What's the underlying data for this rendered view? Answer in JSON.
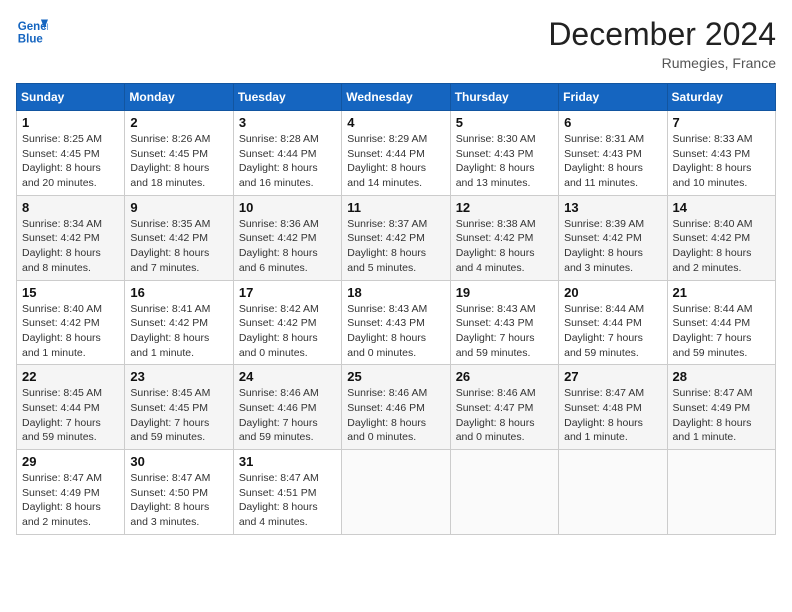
{
  "header": {
    "logo_line1": "General",
    "logo_line2": "Blue",
    "month_title": "December 2024",
    "location": "Rumegies, France"
  },
  "days_of_week": [
    "Sunday",
    "Monday",
    "Tuesday",
    "Wednesday",
    "Thursday",
    "Friday",
    "Saturday"
  ],
  "weeks": [
    [
      {
        "day": "1",
        "info": "Sunrise: 8:25 AM\nSunset: 4:45 PM\nDaylight: 8 hours\nand 20 minutes."
      },
      {
        "day": "2",
        "info": "Sunrise: 8:26 AM\nSunset: 4:45 PM\nDaylight: 8 hours\nand 18 minutes."
      },
      {
        "day": "3",
        "info": "Sunrise: 8:28 AM\nSunset: 4:44 PM\nDaylight: 8 hours\nand 16 minutes."
      },
      {
        "day": "4",
        "info": "Sunrise: 8:29 AM\nSunset: 4:44 PM\nDaylight: 8 hours\nand 14 minutes."
      },
      {
        "day": "5",
        "info": "Sunrise: 8:30 AM\nSunset: 4:43 PM\nDaylight: 8 hours\nand 13 minutes."
      },
      {
        "day": "6",
        "info": "Sunrise: 8:31 AM\nSunset: 4:43 PM\nDaylight: 8 hours\nand 11 minutes."
      },
      {
        "day": "7",
        "info": "Sunrise: 8:33 AM\nSunset: 4:43 PM\nDaylight: 8 hours\nand 10 minutes."
      }
    ],
    [
      {
        "day": "8",
        "info": "Sunrise: 8:34 AM\nSunset: 4:42 PM\nDaylight: 8 hours\nand 8 minutes."
      },
      {
        "day": "9",
        "info": "Sunrise: 8:35 AM\nSunset: 4:42 PM\nDaylight: 8 hours\nand 7 minutes."
      },
      {
        "day": "10",
        "info": "Sunrise: 8:36 AM\nSunset: 4:42 PM\nDaylight: 8 hours\nand 6 minutes."
      },
      {
        "day": "11",
        "info": "Sunrise: 8:37 AM\nSunset: 4:42 PM\nDaylight: 8 hours\nand 5 minutes."
      },
      {
        "day": "12",
        "info": "Sunrise: 8:38 AM\nSunset: 4:42 PM\nDaylight: 8 hours\nand 4 minutes."
      },
      {
        "day": "13",
        "info": "Sunrise: 8:39 AM\nSunset: 4:42 PM\nDaylight: 8 hours\nand 3 minutes."
      },
      {
        "day": "14",
        "info": "Sunrise: 8:40 AM\nSunset: 4:42 PM\nDaylight: 8 hours\nand 2 minutes."
      }
    ],
    [
      {
        "day": "15",
        "info": "Sunrise: 8:40 AM\nSunset: 4:42 PM\nDaylight: 8 hours\nand 1 minute."
      },
      {
        "day": "16",
        "info": "Sunrise: 8:41 AM\nSunset: 4:42 PM\nDaylight: 8 hours\nand 1 minute."
      },
      {
        "day": "17",
        "info": "Sunrise: 8:42 AM\nSunset: 4:42 PM\nDaylight: 8 hours\nand 0 minutes."
      },
      {
        "day": "18",
        "info": "Sunrise: 8:43 AM\nSunset: 4:43 PM\nDaylight: 8 hours\nand 0 minutes."
      },
      {
        "day": "19",
        "info": "Sunrise: 8:43 AM\nSunset: 4:43 PM\nDaylight: 7 hours\nand 59 minutes."
      },
      {
        "day": "20",
        "info": "Sunrise: 8:44 AM\nSunset: 4:44 PM\nDaylight: 7 hours\nand 59 minutes."
      },
      {
        "day": "21",
        "info": "Sunrise: 8:44 AM\nSunset: 4:44 PM\nDaylight: 7 hours\nand 59 minutes."
      }
    ],
    [
      {
        "day": "22",
        "info": "Sunrise: 8:45 AM\nSunset: 4:44 PM\nDaylight: 7 hours\nand 59 minutes."
      },
      {
        "day": "23",
        "info": "Sunrise: 8:45 AM\nSunset: 4:45 PM\nDaylight: 7 hours\nand 59 minutes."
      },
      {
        "day": "24",
        "info": "Sunrise: 8:46 AM\nSunset: 4:46 PM\nDaylight: 7 hours\nand 59 minutes."
      },
      {
        "day": "25",
        "info": "Sunrise: 8:46 AM\nSunset: 4:46 PM\nDaylight: 8 hours\nand 0 minutes."
      },
      {
        "day": "26",
        "info": "Sunrise: 8:46 AM\nSunset: 4:47 PM\nDaylight: 8 hours\nand 0 minutes."
      },
      {
        "day": "27",
        "info": "Sunrise: 8:47 AM\nSunset: 4:48 PM\nDaylight: 8 hours\nand 1 minute."
      },
      {
        "day": "28",
        "info": "Sunrise: 8:47 AM\nSunset: 4:49 PM\nDaylight: 8 hours\nand 1 minute."
      }
    ],
    [
      {
        "day": "29",
        "info": "Sunrise: 8:47 AM\nSunset: 4:49 PM\nDaylight: 8 hours\nand 2 minutes."
      },
      {
        "day": "30",
        "info": "Sunrise: 8:47 AM\nSunset: 4:50 PM\nDaylight: 8 hours\nand 3 minutes."
      },
      {
        "day": "31",
        "info": "Sunrise: 8:47 AM\nSunset: 4:51 PM\nDaylight: 8 hours\nand 4 minutes."
      },
      {
        "day": "",
        "info": ""
      },
      {
        "day": "",
        "info": ""
      },
      {
        "day": "",
        "info": ""
      },
      {
        "day": "",
        "info": ""
      }
    ]
  ]
}
